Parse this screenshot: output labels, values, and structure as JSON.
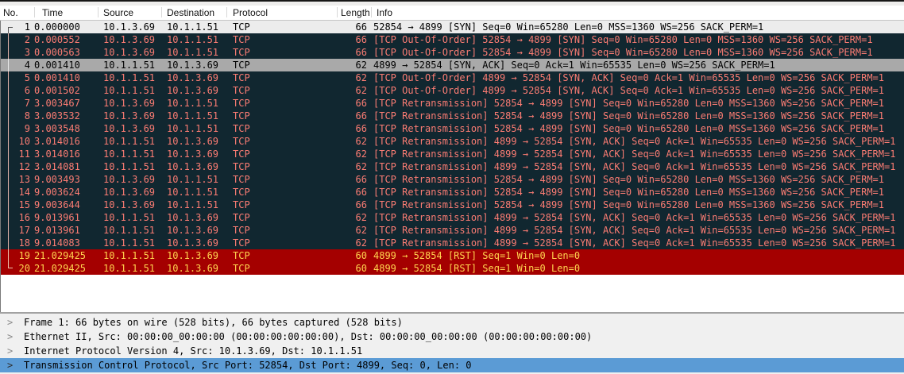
{
  "colors": {
    "accent_selection_blue": "#5b9bd5",
    "bad_tcp_bg": "#112730",
    "bad_tcp_fg": "#fb7c73",
    "rst_bg": "#a40000",
    "rst_fg": "#ffd34f",
    "selected_row_bg": "#a9a9a9",
    "first_row_bg": "#ececec",
    "detail_pane_bg": "#f0f0f0"
  },
  "packet_list": {
    "columns": [
      "No.",
      "Time",
      "Source",
      "Destination",
      "Protocol",
      "Length",
      "Info"
    ],
    "rows": [
      {
        "no": "1",
        "time": "0.000000",
        "source": "10.1.3.69",
        "destination": "10.1.1.51",
        "protocol": "TCP",
        "length": "66",
        "info": "52854 → 4899 [SYN] Seq=0 Win=65280 Len=0 MSS=1360 WS=256 SACK_PERM=1",
        "style": "light",
        "bracket": "start"
      },
      {
        "no": "2",
        "time": "0.000552",
        "source": "10.1.3.69",
        "destination": "10.1.1.51",
        "protocol": "TCP",
        "length": "66",
        "info": "[TCP Out-Of-Order] 52854 → 4899 [SYN] Seq=0 Win=65280 Len=0 MSS=1360 WS=256 SACK_PERM=1",
        "style": "bad",
        "bracket": "mid"
      },
      {
        "no": "3",
        "time": "0.000563",
        "source": "10.1.3.69",
        "destination": "10.1.1.51",
        "protocol": "TCP",
        "length": "66",
        "info": "[TCP Out-Of-Order] 52854 → 4899 [SYN] Seq=0 Win=65280 Len=0 MSS=1360 WS=256 SACK_PERM=1",
        "style": "bad",
        "bracket": "mid"
      },
      {
        "no": "4",
        "time": "0.001410",
        "source": "10.1.1.51",
        "destination": "10.1.3.69",
        "protocol": "TCP",
        "length": "62",
        "info": "4899 → 52854 [SYN, ACK] Seq=0 Ack=1 Win=65535 Len=0 WS=256 SACK_PERM=1",
        "style": "selected",
        "bracket": "mid"
      },
      {
        "no": "5",
        "time": "0.001410",
        "source": "10.1.1.51",
        "destination": "10.1.3.69",
        "protocol": "TCP",
        "length": "62",
        "info": "[TCP Out-Of-Order] 4899 → 52854 [SYN, ACK] Seq=0 Ack=1 Win=65535 Len=0 WS=256 SACK_PERM=1",
        "style": "bad",
        "bracket": "mid"
      },
      {
        "no": "6",
        "time": "0.001502",
        "source": "10.1.1.51",
        "destination": "10.1.3.69",
        "protocol": "TCP",
        "length": "62",
        "info": "[TCP Out-Of-Order] 4899 → 52854 [SYN, ACK] Seq=0 Ack=1 Win=65535 Len=0 WS=256 SACK_PERM=1",
        "style": "bad",
        "bracket": "mid"
      },
      {
        "no": "7",
        "time": "3.003467",
        "source": "10.1.3.69",
        "destination": "10.1.1.51",
        "protocol": "TCP",
        "length": "66",
        "info": "[TCP Retransmission] 52854 → 4899 [SYN] Seq=0 Win=65280 Len=0 MSS=1360 WS=256 SACK_PERM=1",
        "style": "bad",
        "bracket": "mid"
      },
      {
        "no": "8",
        "time": "3.003532",
        "source": "10.1.3.69",
        "destination": "10.1.1.51",
        "protocol": "TCP",
        "length": "66",
        "info": "[TCP Retransmission] 52854 → 4899 [SYN] Seq=0 Win=65280 Len=0 MSS=1360 WS=256 SACK_PERM=1",
        "style": "bad",
        "bracket": "mid"
      },
      {
        "no": "9",
        "time": "3.003548",
        "source": "10.1.3.69",
        "destination": "10.1.1.51",
        "protocol": "TCP",
        "length": "66",
        "info": "[TCP Retransmission] 52854 → 4899 [SYN] Seq=0 Win=65280 Len=0 MSS=1360 WS=256 SACK_PERM=1",
        "style": "bad",
        "bracket": "mid"
      },
      {
        "no": "10",
        "time": "3.014016",
        "source": "10.1.1.51",
        "destination": "10.1.3.69",
        "protocol": "TCP",
        "length": "62",
        "info": "[TCP Retransmission] 4899 → 52854 [SYN, ACK] Seq=0 Ack=1 Win=65535 Len=0 WS=256 SACK_PERM=1",
        "style": "bad",
        "bracket": "mid"
      },
      {
        "no": "11",
        "time": "3.014016",
        "source": "10.1.1.51",
        "destination": "10.1.3.69",
        "protocol": "TCP",
        "length": "62",
        "info": "[TCP Retransmission] 4899 → 52854 [SYN, ACK] Seq=0 Ack=1 Win=65535 Len=0 WS=256 SACK_PERM=1",
        "style": "bad",
        "bracket": "mid"
      },
      {
        "no": "12",
        "time": "3.014081",
        "source": "10.1.1.51",
        "destination": "10.1.3.69",
        "protocol": "TCP",
        "length": "62",
        "info": "[TCP Retransmission] 4899 → 52854 [SYN, ACK] Seq=0 Ack=1 Win=65535 Len=0 WS=256 SACK_PERM=1",
        "style": "bad",
        "bracket": "mid"
      },
      {
        "no": "13",
        "time": "9.003493",
        "source": "10.1.3.69",
        "destination": "10.1.1.51",
        "protocol": "TCP",
        "length": "66",
        "info": "[TCP Retransmission] 52854 → 4899 [SYN] Seq=0 Win=65280 Len=0 MSS=1360 WS=256 SACK_PERM=1",
        "style": "bad",
        "bracket": "mid"
      },
      {
        "no": "14",
        "time": "9.003624",
        "source": "10.1.3.69",
        "destination": "10.1.1.51",
        "protocol": "TCP",
        "length": "66",
        "info": "[TCP Retransmission] 52854 → 4899 [SYN] Seq=0 Win=65280 Len=0 MSS=1360 WS=256 SACK_PERM=1",
        "style": "bad",
        "bracket": "mid"
      },
      {
        "no": "15",
        "time": "9.003644",
        "source": "10.1.3.69",
        "destination": "10.1.1.51",
        "protocol": "TCP",
        "length": "66",
        "info": "[TCP Retransmission] 52854 → 4899 [SYN] Seq=0 Win=65280 Len=0 MSS=1360 WS=256 SACK_PERM=1",
        "style": "bad",
        "bracket": "mid"
      },
      {
        "no": "16",
        "time": "9.013961",
        "source": "10.1.1.51",
        "destination": "10.1.3.69",
        "protocol": "TCP",
        "length": "62",
        "info": "[TCP Retransmission] 4899 → 52854 [SYN, ACK] Seq=0 Ack=1 Win=65535 Len=0 WS=256 SACK_PERM=1",
        "style": "bad",
        "bracket": "mid"
      },
      {
        "no": "17",
        "time": "9.013961",
        "source": "10.1.1.51",
        "destination": "10.1.3.69",
        "protocol": "TCP",
        "length": "62",
        "info": "[TCP Retransmission] 4899 → 52854 [SYN, ACK] Seq=0 Ack=1 Win=65535 Len=0 WS=256 SACK_PERM=1",
        "style": "bad",
        "bracket": "mid"
      },
      {
        "no": "18",
        "time": "9.014083",
        "source": "10.1.1.51",
        "destination": "10.1.3.69",
        "protocol": "TCP",
        "length": "62",
        "info": "[TCP Retransmission] 4899 → 52854 [SYN, ACK] Seq=0 Ack=1 Win=65535 Len=0 WS=256 SACK_PERM=1",
        "style": "bad",
        "bracket": "mid"
      },
      {
        "no": "19",
        "time": "21.029425",
        "source": "10.1.1.51",
        "destination": "10.1.3.69",
        "protocol": "TCP",
        "length": "60",
        "info": "4899 → 52854 [RST] Seq=1 Win=0 Len=0",
        "style": "rst",
        "bracket": "mid"
      },
      {
        "no": "20",
        "time": "21.029425",
        "source": "10.1.1.51",
        "destination": "10.1.3.69",
        "protocol": "TCP",
        "length": "60",
        "info": "4899 → 52854 [RST] Seq=1 Win=0 Len=0",
        "style": "rst",
        "bracket": "end"
      }
    ]
  },
  "detail_pane": {
    "expander_icon": ">",
    "rows": [
      {
        "text": "Frame 1: 66 bytes on wire (528 bits), 66 bytes captured (528 bits)",
        "selected": false
      },
      {
        "text": "Ethernet II, Src: 00:00:00_00:00:00 (00:00:00:00:00:00), Dst: 00:00:00_00:00:00 (00:00:00:00:00:00)",
        "selected": false
      },
      {
        "text": "Internet Protocol Version 4, Src: 10.1.3.69, Dst: 10.1.1.51",
        "selected": false
      },
      {
        "text": "Transmission Control Protocol, Src Port: 52854, Dst Port: 4899, Seq: 0, Len: 0",
        "selected": true
      }
    ]
  }
}
